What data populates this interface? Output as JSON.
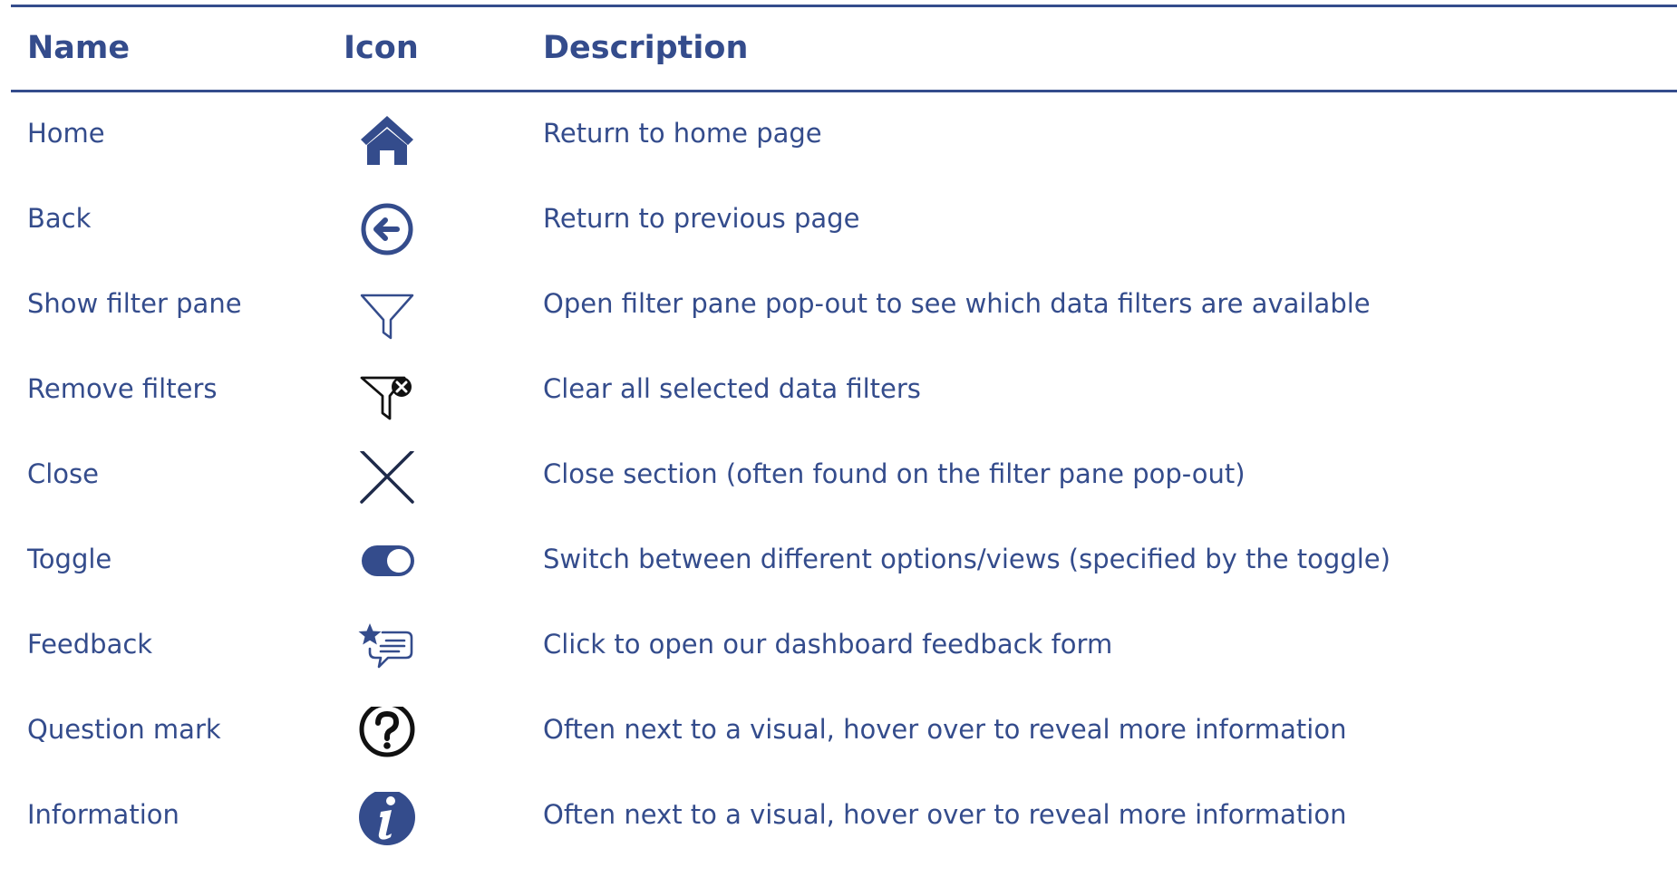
{
  "headers": {
    "name": "Name",
    "icon": "Icon",
    "description": "Description"
  },
  "rows": [
    {
      "name": "Home",
      "icon": "home-icon",
      "description": "Return to home page"
    },
    {
      "name": "Back",
      "icon": "back-arrow-circle-icon",
      "description": "Return to previous page"
    },
    {
      "name": "Show filter pane",
      "icon": "funnel-outline-icon",
      "description": "Open filter pane pop-out to see which data filters are available"
    },
    {
      "name": "Remove filters",
      "icon": "funnel-remove-icon",
      "description": "Clear all selected data filters"
    },
    {
      "name": "Close",
      "icon": "close-x-icon",
      "description": "Close section (often found on the filter pane pop-out)"
    },
    {
      "name": "Toggle",
      "icon": "toggle-switch-icon",
      "description": "Switch between different options/views (specified by the toggle)"
    },
    {
      "name": "Feedback",
      "icon": "star-speech-bubble-icon",
      "description": "Click to open our dashboard feedback form"
    },
    {
      "name": "Question mark",
      "icon": "question-circle-icon",
      "description": "Often next to a visual, hover over to reveal more information"
    },
    {
      "name": "Information",
      "icon": "info-circle-icon",
      "description": "Often next to a visual, hover over to reveal more information"
    }
  ],
  "colors": {
    "text": "#344c8c",
    "rule": "#344c8c",
    "icon_black": "#111111"
  }
}
